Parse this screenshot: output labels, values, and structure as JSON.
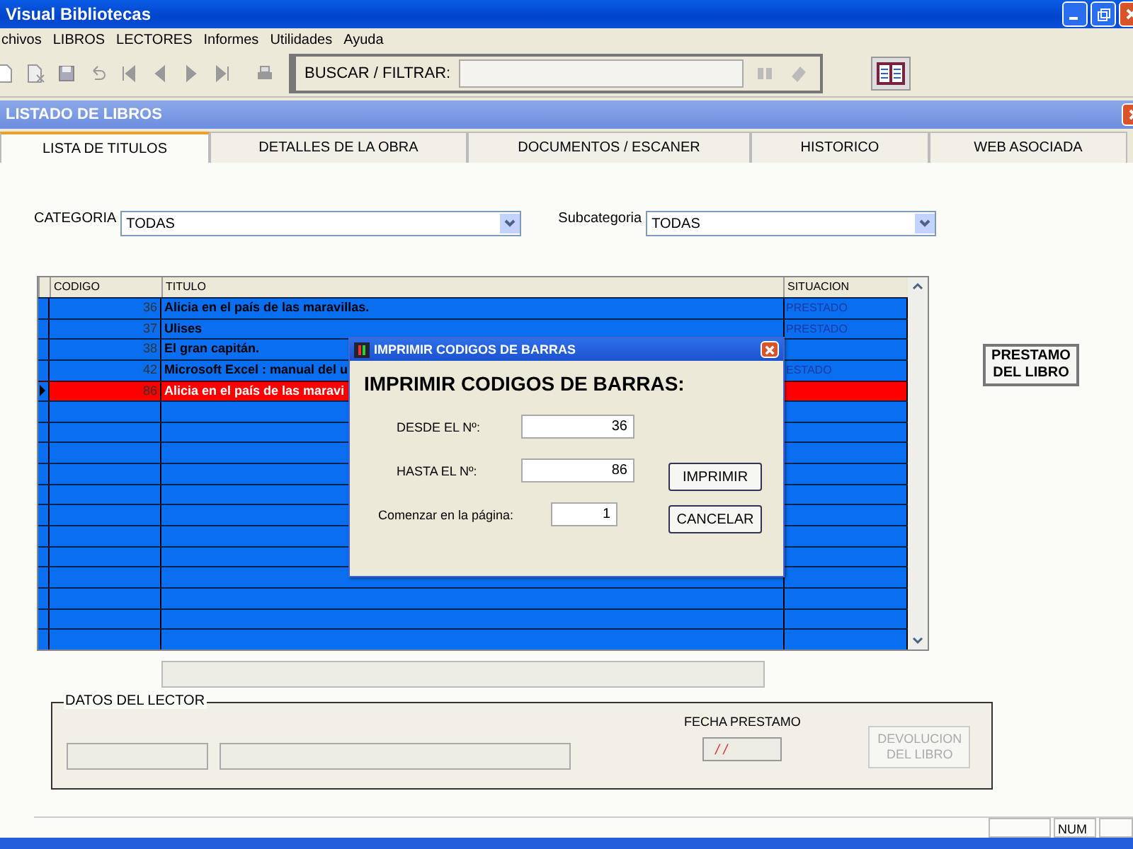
{
  "window": {
    "title": "Visual Bibliotecas"
  },
  "menu": [
    "chivos",
    "LIBROS",
    "LECTORES",
    "Informes",
    "Utilidades",
    "Ayuda"
  ],
  "toolbar": {
    "search_label": "BUSCAR / FILTRAR:"
  },
  "child_window": {
    "title": "LISTADO DE LIBROS"
  },
  "tabs": [
    {
      "label": "LISTA DE TITULOS",
      "selected": true
    },
    {
      "label": "DETALLES DE LA OBRA",
      "selected": false
    },
    {
      "label": "DOCUMENTOS / ESCANER",
      "selected": false
    },
    {
      "label": "HISTORICO",
      "selected": false
    },
    {
      "label": "WEB ASOCIADA",
      "selected": false
    }
  ],
  "filters": [
    {
      "label": "CATEGORIA",
      "value": "TODAS"
    },
    {
      "label": "Subcategoria",
      "value": "TODAS"
    }
  ],
  "table": {
    "columns": [
      "CODIGO",
      "TITULO",
      "SITUACION"
    ],
    "rows": [
      {
        "codigo": "36",
        "titulo": "Alicia en el país de las maravillas.",
        "situacion": "PRESTADO",
        "selected": false
      },
      {
        "codigo": "37",
        "titulo": "Ulises",
        "situacion": "PRESTADO",
        "selected": false
      },
      {
        "codigo": "38",
        "titulo": "El gran capitán.",
        "selected": false
      },
      {
        "codigo": "42",
        "titulo": "Microsoft Excel : manual del u",
        "situacion": "ESTADO",
        "selected": false
      },
      {
        "codigo": "86",
        "titulo": "Alicia en el país de las maravi",
        "selected": true
      }
    ]
  },
  "loan_button": "PRESTAMO DEL LIBRO",
  "reader": {
    "title": "DATOS DEL LECTOR",
    "date_label": "FECHA PRESTAMO",
    "date_value": "/ /",
    "return_button": {
      "label": "DEVOLUCION DEL LIBRO",
      "disabled": true
    }
  },
  "status_bar": {
    "num": "NUM"
  },
  "dialog": {
    "title": "IMPRIMIR CODIGOS DE BARRAS",
    "heading": "IMPRIMIR CODIGOS DE BARRAS:",
    "fields": [
      {
        "label": "DESDE EL Nº:",
        "value": "36"
      },
      {
        "label": "HASTA EL Nº:",
        "value": "86"
      },
      {
        "label": "Comenzar en la página:",
        "value": "1"
      }
    ],
    "buttons": [
      "IMPRIMIR",
      "CANCELAR"
    ]
  }
}
